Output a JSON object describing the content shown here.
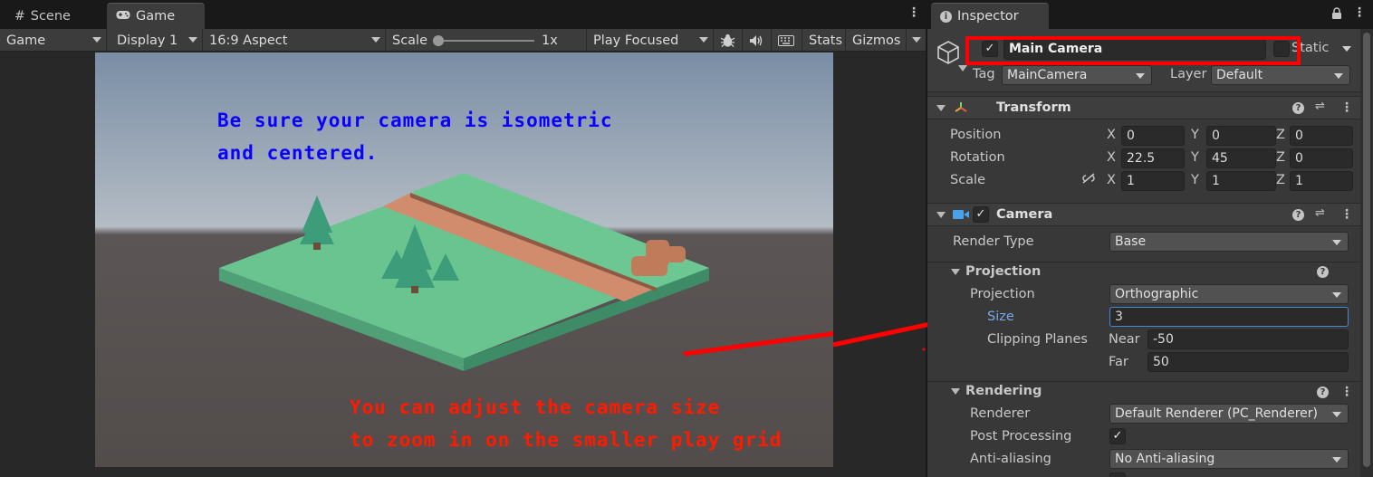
{
  "game": {
    "tabs": {
      "scene": "Scene",
      "game": "Game"
    },
    "toolbar": {
      "view_mode": "Game",
      "display": "Display 1",
      "aspect": "16:9 Aspect",
      "scale_label": "Scale",
      "scale_value": "1x",
      "play_mode": "Play Focused",
      "stats": "Stats",
      "gizmos": "Gizmos"
    },
    "hint_top": "Be sure your camera is isometric\nand centered.",
    "hint_bottom": "You can adjust the camera size\nto zoom in on the smaller play grid",
    "colors": {
      "hint_top": "#0b00ff",
      "hint_bottom": "#ff1a00",
      "annotation": "#ff0000"
    }
  },
  "inspector": {
    "tab": "Inspector",
    "object_name": "Main Camera",
    "active_checked": true,
    "static_label": "Static",
    "tag_label": "Tag",
    "tag_value": "MainCamera",
    "layer_label": "Layer",
    "layer_value": "Default",
    "transform": {
      "title": "Transform",
      "position_label": "Position",
      "rotation_label": "Rotation",
      "scale_label": "Scale",
      "position": {
        "x": "0",
        "y": "0",
        "z": "0"
      },
      "rotation": {
        "x": "22.5",
        "y": "45",
        "z": "0"
      },
      "scale": {
        "x": "1",
        "y": "1",
        "z": "1"
      },
      "axes": {
        "x": "X",
        "y": "Y",
        "z": "Z"
      }
    },
    "camera": {
      "title": "Camera",
      "render_type_label": "Render Type",
      "render_type": "Base",
      "projection_section": "Projection",
      "projection_label": "Projection",
      "projection": "Orthographic",
      "size_label": "Size",
      "size": "3",
      "clipping_label": "Clipping Planes",
      "near_label": "Near",
      "near": "-50",
      "far_label": "Far",
      "far": "50",
      "rendering_section": "Rendering",
      "renderer_label": "Renderer",
      "renderer": "Default Renderer (PC_Renderer)",
      "post_processing_label": "Post Processing",
      "post_processing": true,
      "anti_aliasing_label": "Anti-aliasing",
      "anti_aliasing": "No Anti-aliasing"
    }
  }
}
